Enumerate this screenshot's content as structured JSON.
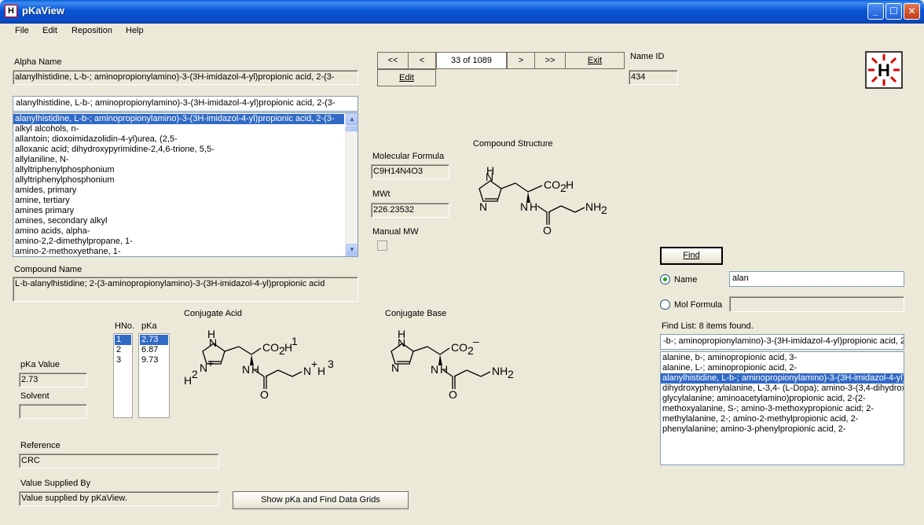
{
  "window": {
    "title": "pKaView"
  },
  "menu": [
    "File",
    "Edit",
    "Reposition",
    "Help"
  ],
  "alpha_name": {
    "label": "Alpha Name",
    "value": "alanylhistidine, L-b-; aminopropionylamino)-3-(3H-imidazol-4-yl)propionic acid, 2-(3-",
    "combo_value": "alanylhistidine, L-b-; aminopropionylamino)-3-(3H-imidazol-4-yl)propionic acid, 2-(3-",
    "list": [
      "alanylhistidine, L-b-; aminopropionylamino)-3-(3H-imidazol-4-yl)propionic acid, 2-(3-",
      "alkyl alcohols, n-",
      "allantoin; dioxoimidazolidin-4-yl)urea, (2,5-",
      "alloxanic acid; dihydroxypyrimidine-2,4,6-trione, 5,5-",
      "allylaniline, N-",
      "allyltriphenylphosphonium",
      "allyltriphenylphosphonium",
      "amides, primary",
      "amine, tertiary",
      "amines primary",
      "amines, secondary alkyl",
      "amino acids, alpha-",
      "amino-2,2-dimethylpropane, 1-",
      "amino-2-methoxyethane, 1-"
    ]
  },
  "nav": {
    "first": "<<",
    "prev": "<",
    "record": "33 of  1089",
    "next": ">",
    "last": ">>",
    "exit": "Exit",
    "edit": "Edit"
  },
  "name_id": {
    "label": "Name ID",
    "value": "434"
  },
  "compound_structure_label": "Compound Structure",
  "molecular_formula": {
    "label": "Molecular Formula",
    "value": "C9H14N4O3"
  },
  "mw": {
    "label": "MWt",
    "value": "226.23532"
  },
  "manual_mw": {
    "label": "Manual MW",
    "checked": false
  },
  "compound_name": {
    "label": "Compound Name",
    "value": "L-b-alanylhistidine; 2-(3-aminopropionylamino)-3-(3H-imidazol-4-yl)propionic acid"
  },
  "conjugate_acid_label": "Conjugate Acid",
  "conjugate_base_label": "Conjugate Base",
  "hno": {
    "label": "HNo.",
    "values": [
      "1",
      "2",
      "3"
    ]
  },
  "pka": {
    "label": "pKa",
    "values": [
      "2.73",
      "6.87",
      "9.73"
    ]
  },
  "pka_value": {
    "label": "pKa Value",
    "value": "2.73"
  },
  "solvent": {
    "label": "Solvent",
    "value": ""
  },
  "reference": {
    "label": "Reference",
    "value": "CRC"
  },
  "value_supplied_by": {
    "label": "Value Supplied By",
    "value": "Value supplied by pKaView."
  },
  "show_grids_button": "Show pKa and Find Data Grids",
  "find": {
    "button": "Find",
    "name_label": "Name",
    "name_value": "alan",
    "mol_formula_label": "Mol Formula",
    "mol_formula_value": "",
    "search_by": "Name",
    "list_label": "Find List: 8 items found.",
    "combo_value": "-b-; aminopropionylamino)-3-(3H-imidazol-4-yl)propionic acid, 2-(3-",
    "results": [
      "alanine, b-; aminopropionic acid, 3-",
      "alanine, L-; aminopropionic acid, 2-",
      "alanylhistidine, L-b-; aminopropionylamino)-3-(3H-imidazol-4-yl)propionic acid, 2-(3-",
      "dihydroxyphenylalanine, L-3,4- (L-Dopa); amino-3-(3,4-dihydroxyphenyl)propionic acid, 2-",
      "glycylalanine; aminoacetylamino)propionic acid, 2-(2-",
      "methoxyalanine, S-; amino-3-methoxypropionic acid; 2-",
      "methylalanine, 2-; amino-2-methylpropionic acid, 2-",
      "phenylalanine; amino-3-phenylpropionic acid, 2-"
    ],
    "selected_index": 2
  },
  "structures": {
    "compound": {
      "nh_label": "H",
      "n1": "N",
      "n2": "N",
      "acid": "CO",
      "acid_sub": "2",
      "acid_h": "H",
      "amide_n": "N",
      "amide_h": "H",
      "o": "O",
      "amine": "NH",
      "amine_sub": "2"
    },
    "acid": {
      "h_top": "H",
      "n_top": "N",
      "n_bot": "N",
      "plus": "+",
      "h_bot": "H",
      "acid": "CO",
      "acid_sub": "2",
      "acid_h": "H",
      "acid_sup": "1",
      "amide_n": "N",
      "amide_h": "H",
      "o": "O",
      "amine": "N",
      "amine_sup": "+",
      "amine_h": "H",
      "amine_sub": "3",
      "h_bot_sup": "2"
    },
    "base": {
      "h_top": "H",
      "n_top": "N",
      "n_bot": "N",
      "acid": "CO",
      "acid_sub": "2",
      "acid_sup": "–",
      "amide_n": "N",
      "amide_h": "H",
      "o": "O",
      "amine": "NH",
      "amine_sub": "2"
    }
  }
}
